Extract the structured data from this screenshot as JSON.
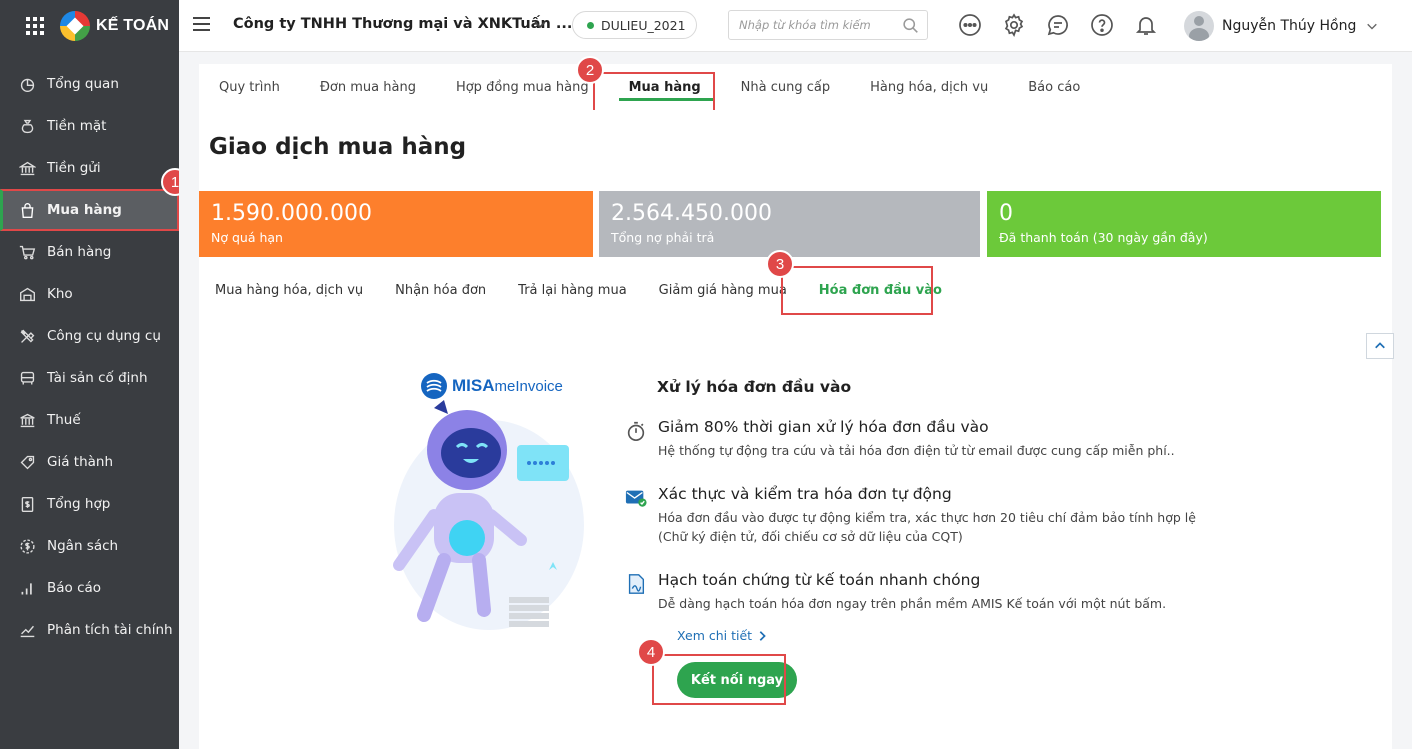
{
  "brand": {
    "name": "KẾ TOÁN"
  },
  "sidebar": {
    "items": [
      {
        "label": "Tổng quan",
        "icon": "dashboard-icon"
      },
      {
        "label": "Tiền mặt",
        "icon": "money-bag-icon"
      },
      {
        "label": "Tiền gửi",
        "icon": "bank-icon"
      },
      {
        "label": "Mua hàng",
        "icon": "shopping-bag-icon",
        "active": true
      },
      {
        "label": "Bán hàng",
        "icon": "cart-icon"
      },
      {
        "label": "Kho",
        "icon": "warehouse-icon"
      },
      {
        "label": "Công cụ dụng cụ",
        "icon": "tools-icon"
      },
      {
        "label": "Tài sản cố định",
        "icon": "car-icon"
      },
      {
        "label": "Thuế",
        "icon": "tax-building-icon"
      },
      {
        "label": "Giá thành",
        "icon": "price-tag-icon"
      },
      {
        "label": "Tổng hợp",
        "icon": "document-dollar-icon"
      },
      {
        "label": "Ngân sách",
        "icon": "budget-coin-icon"
      },
      {
        "label": "Báo cáo",
        "icon": "bar-chart-icon"
      },
      {
        "label": "Phân tích tài chính",
        "icon": "trend-line-icon"
      }
    ]
  },
  "header": {
    "company": "Công ty TNHH Thương mại và XNKTuấn ...",
    "database": "DULIEU_2021",
    "search_placeholder": "Nhập từ khóa tìm kiếm",
    "user_name": "Nguyễn Thúy Hồng"
  },
  "tabs": [
    {
      "label": "Quy trình"
    },
    {
      "label": "Đơn mua hàng"
    },
    {
      "label": "Hợp đồng mua hàng"
    },
    {
      "label": "Mua hàng",
      "active": true
    },
    {
      "label": "Nhà cung cấp"
    },
    {
      "label": "Hàng hóa, dịch vụ"
    },
    {
      "label": "Báo cáo"
    }
  ],
  "page": {
    "title": "Giao dịch mua hàng"
  },
  "cards": [
    {
      "value": "1.590.000.000",
      "label": "Nợ quá hạn",
      "color": "#fd7f2c"
    },
    {
      "value": "2.564.450.000",
      "label": "Tổng nợ phải trả",
      "color": "#b5b8bd"
    },
    {
      "value": "0",
      "label": "Đã thanh toán (30 ngày gần đây)",
      "color": "#6cc93a"
    }
  ],
  "subtabs": [
    {
      "label": "Mua hàng hóa, dịch vụ"
    },
    {
      "label": "Nhận hóa đơn"
    },
    {
      "label": "Trả lại hàng mua"
    },
    {
      "label": "Giảm giá hàng mua"
    },
    {
      "label": "Hóa đơn đầu vào",
      "active": true
    }
  ],
  "product": {
    "brand": "MISA",
    "name": "meInvoice"
  },
  "intro": {
    "title": "Xử lý hóa đơn đầu vào",
    "features": [
      {
        "icon": "stopwatch-icon",
        "heading": "Giảm 80% thời gian xử lý hóa đơn đầu vào",
        "desc": "Hệ thống tự động tra cứu và tải hóa đơn điện tử từ email được cung cấp miễn phí.."
      },
      {
        "icon": "email-check-icon",
        "heading": "Xác thực và kiểm tra hóa đơn tự động",
        "desc": "Hóa đơn đầu vào được tự động kiểm tra, xác thực hơn 20 tiêu chí đảm bảo tính hợp lệ (Chữ ký điện tử, đối chiếu cơ sở dữ liệu của CQT)"
      },
      {
        "icon": "document-sign-icon",
        "heading": "Hạch toán chứng từ kế toán nhanh chóng",
        "desc": "Dễ dàng hạch toán hóa đơn ngay trên phần mềm AMIS Kế toán với một nút bấm."
      }
    ],
    "more_link": "Xem chi tiết",
    "connect_button": "Kết nối ngay"
  },
  "callouts": [
    "1",
    "2",
    "3",
    "4"
  ],
  "colors": {
    "accent": "#2ea44f",
    "highlight": "#e04848",
    "sidebar": "#3a3d41"
  }
}
